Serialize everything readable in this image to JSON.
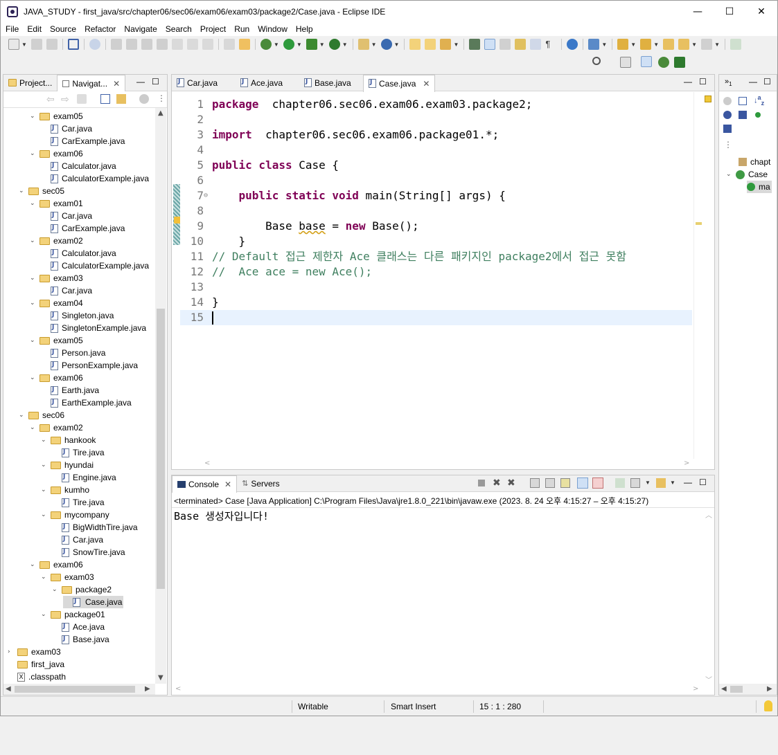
{
  "window": {
    "title": "JAVA_STUDY - first_java/src/chapter06/sec06/exam06/exam03/package2/Case.java - Eclipse IDE",
    "minimize": "—",
    "maximize": "☐",
    "close": "✕"
  },
  "menu": [
    "File",
    "Edit",
    "Source",
    "Refactor",
    "Navigate",
    "Search",
    "Project",
    "Run",
    "Window",
    "Help"
  ],
  "explorer": {
    "tabs": [
      "Project...",
      "Navigat..."
    ],
    "tree": [
      {
        "label": "exam05",
        "type": "folder",
        "depth": 2,
        "exp": true
      },
      {
        "label": "Car.java",
        "type": "java",
        "depth": 3
      },
      {
        "label": "CarExample.java",
        "type": "java",
        "depth": 3
      },
      {
        "label": "exam06",
        "type": "folder",
        "depth": 2,
        "exp": true
      },
      {
        "label": "Calculator.java",
        "type": "java",
        "depth": 3
      },
      {
        "label": "CalculatorExample.java",
        "type": "java",
        "depth": 3
      },
      {
        "label": "sec05",
        "type": "folder",
        "depth": 1,
        "exp": true
      },
      {
        "label": "exam01",
        "type": "folder",
        "depth": 2,
        "exp": true
      },
      {
        "label": "Car.java",
        "type": "java",
        "depth": 3
      },
      {
        "label": "CarExample.java",
        "type": "java",
        "depth": 3
      },
      {
        "label": "exam02",
        "type": "folder",
        "depth": 2,
        "exp": true
      },
      {
        "label": "Calculator.java",
        "type": "java",
        "depth": 3
      },
      {
        "label": "CalculatorExample.java",
        "type": "java",
        "depth": 3
      },
      {
        "label": "exam03",
        "type": "folder",
        "depth": 2,
        "exp": true
      },
      {
        "label": "Car.java",
        "type": "java",
        "depth": 3
      },
      {
        "label": "exam04",
        "type": "folder",
        "depth": 2,
        "exp": true
      },
      {
        "label": "Singleton.java",
        "type": "java",
        "depth": 3
      },
      {
        "label": "SingletonExample.java",
        "type": "java",
        "depth": 3
      },
      {
        "label": "exam05",
        "type": "folder",
        "depth": 2,
        "exp": true
      },
      {
        "label": "Person.java",
        "type": "java",
        "depth": 3
      },
      {
        "label": "PersonExample.java",
        "type": "java",
        "depth": 3
      },
      {
        "label": "exam06",
        "type": "folder",
        "depth": 2,
        "exp": true
      },
      {
        "label": "Earth.java",
        "type": "java",
        "depth": 3
      },
      {
        "label": "EarthExample.java",
        "type": "java",
        "depth": 3
      },
      {
        "label": "sec06",
        "type": "folder",
        "depth": 1,
        "exp": true
      },
      {
        "label": "exam02",
        "type": "folder",
        "depth": 2,
        "exp": true
      },
      {
        "label": "hankook",
        "type": "folder",
        "depth": 3,
        "exp": true
      },
      {
        "label": "Tire.java",
        "type": "java",
        "depth": 4
      },
      {
        "label": "hyundai",
        "type": "folder",
        "depth": 3,
        "exp": true
      },
      {
        "label": "Engine.java",
        "type": "java",
        "depth": 4
      },
      {
        "label": "kumho",
        "type": "folder",
        "depth": 3,
        "exp": true
      },
      {
        "label": "Tire.java",
        "type": "java",
        "depth": 4
      },
      {
        "label": "mycompany",
        "type": "folder",
        "depth": 3,
        "exp": true
      },
      {
        "label": "BigWidthTire.java",
        "type": "java",
        "depth": 4
      },
      {
        "label": "Car.java",
        "type": "java",
        "depth": 4
      },
      {
        "label": "SnowTire.java",
        "type": "java",
        "depth": 4
      },
      {
        "label": "exam06",
        "type": "folder",
        "depth": 2,
        "exp": true
      },
      {
        "label": "exam03",
        "type": "folder",
        "depth": 3,
        "exp": true
      },
      {
        "label": "package2",
        "type": "folder",
        "depth": 4,
        "exp": true
      },
      {
        "label": "Case.java",
        "type": "java",
        "depth": 5,
        "selected": true
      },
      {
        "label": "package01",
        "type": "folder",
        "depth": 3,
        "exp": true
      },
      {
        "label": "Ace.java",
        "type": "java",
        "depth": 4
      },
      {
        "label": "Base.java",
        "type": "java",
        "depth": 4
      },
      {
        "label": "exam03",
        "type": "folder",
        "depth": 0,
        "exp": false
      },
      {
        "label": "first_java",
        "type": "folder",
        "depth": 0,
        "none": true
      },
      {
        "label": ".classpath",
        "type": "x",
        "depth": 0,
        "none": true
      }
    ]
  },
  "editor": {
    "tabs": [
      {
        "label": "Car.java"
      },
      {
        "label": "Ace.java"
      },
      {
        "label": "Base.java"
      },
      {
        "label": "Case.java",
        "active": true
      }
    ],
    "lines": [
      {
        "n": "1",
        "parts": [
          [
            "kw",
            "package"
          ],
          [
            "",
            "  chapter06.sec06.exam06.exam03.package2;"
          ]
        ]
      },
      {
        "n": "2",
        "parts": []
      },
      {
        "n": "3",
        "parts": [
          [
            "kw",
            "import"
          ],
          [
            "",
            "  chapter06.sec06.exam06.package01.*;"
          ]
        ]
      },
      {
        "n": "4",
        "parts": []
      },
      {
        "n": "5",
        "parts": [
          [
            "kw",
            "public class"
          ],
          [
            "",
            " Case {"
          ]
        ]
      },
      {
        "n": "6",
        "parts": []
      },
      {
        "n": "7",
        "parts": [
          [
            "",
            "    "
          ],
          [
            "kw",
            "public static void"
          ],
          [
            "",
            " main(String[] args) {"
          ]
        ]
      },
      {
        "n": "8",
        "parts": []
      },
      {
        "n": "9",
        "parts": [
          [
            "",
            "        Base "
          ],
          [
            "var",
            "base"
          ],
          [
            "",
            " = "
          ],
          [
            "kw",
            "new"
          ],
          [
            "",
            " Base();"
          ]
        ]
      },
      {
        "n": "10",
        "parts": [
          [
            "",
            "    }"
          ]
        ]
      },
      {
        "n": "11",
        "parts": [
          [
            "cm",
            "// Default 접근 제한자 Ace 클래스는 다른 패키지인 package2에서 접근 못함"
          ]
        ]
      },
      {
        "n": "12",
        "parts": [
          [
            "cm",
            "//  Ace ace = new Ace();"
          ]
        ]
      },
      {
        "n": "13",
        "parts": []
      },
      {
        "n": "14",
        "parts": [
          [
            "",
            "}"
          ]
        ]
      },
      {
        "n": "15",
        "parts": []
      }
    ]
  },
  "outline": {
    "items": [
      "chapt",
      "Case",
      "ma"
    ]
  },
  "console": {
    "tabs": [
      "Console",
      "Servers"
    ],
    "header": "<terminated> Case [Java Application] C:\\Program Files\\Java\\jre1.8.0_221\\bin\\javaw.exe  (2023. 8. 24 오후 4:15:27 – 오후 4:15:27)",
    "output": "Base 생성자입니다!"
  },
  "status": {
    "writable": "Writable",
    "insert": "Smart Insert",
    "position": "15 : 1 : 280"
  },
  "colors": {
    "keyword": "#7f0055",
    "comment": "#3f7f5f",
    "lineno": "#787878",
    "current_line": "#e8f2fe"
  }
}
